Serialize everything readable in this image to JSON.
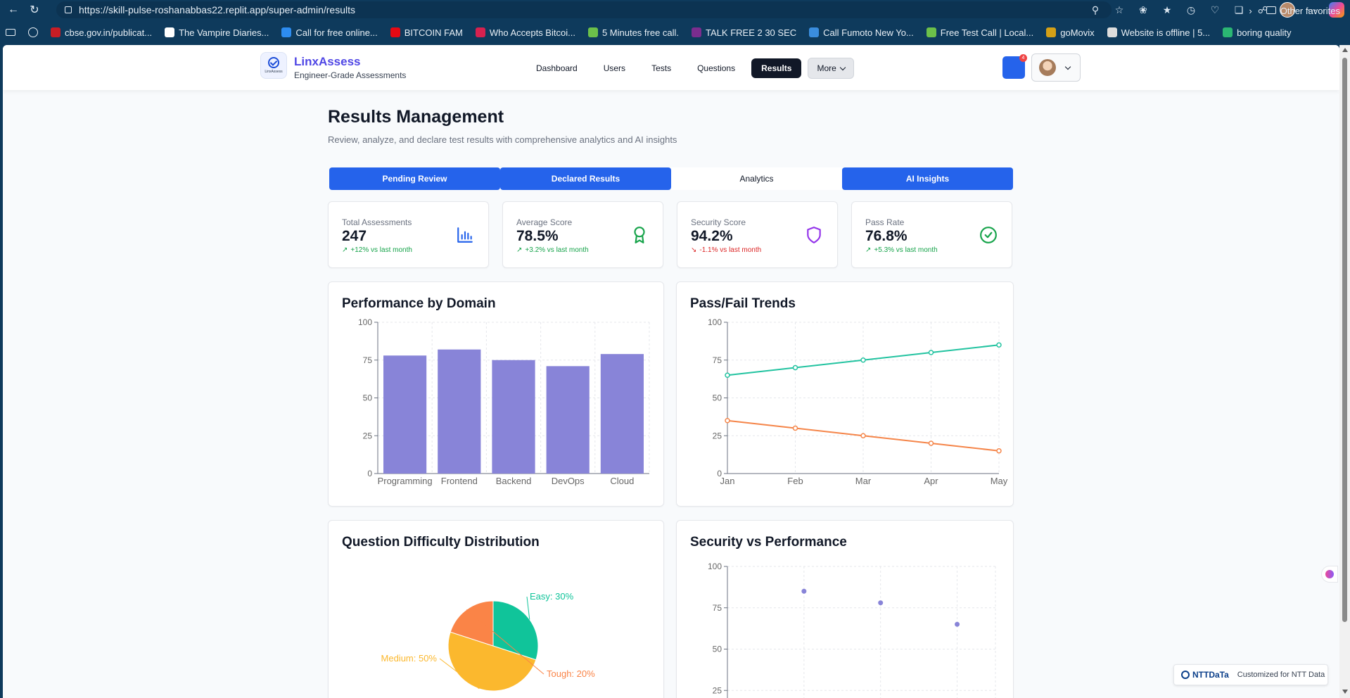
{
  "browser": {
    "url": "https://skill-pulse-roshanabbas22.replit.app/super-admin/results",
    "bookmarks": [
      {
        "label": "cbse.gov.in/publicat...",
        "color": "#c81d25"
      },
      {
        "label": "The Vampire Diaries...",
        "color": "#ffffff"
      },
      {
        "label": "Call for free online...",
        "color": "#2d8cf0"
      },
      {
        "label": "BITCOIN FAM",
        "color": "#e50914"
      },
      {
        "label": "Who Accepts Bitcoi...",
        "color": "#d6214f"
      },
      {
        "label": "5 Minutes free call.",
        "color": "#6cc04a"
      },
      {
        "label": "TALK FREE 2 30 SEC",
        "color": "#7b2d8e"
      },
      {
        "label": "Call Fumoto New Yo...",
        "color": "#3a8dde"
      },
      {
        "label": "Free Test Call | Local...",
        "color": "#6cc04a"
      },
      {
        "label": "goMovix",
        "color": "#d4a017"
      },
      {
        "label": "Website is offline | 5...",
        "color": "#dddddd"
      },
      {
        "label": "boring quality",
        "color": "#2bb673"
      }
    ],
    "other_favorites": "Other favorites"
  },
  "header": {
    "brand_name": "LinxAssess",
    "brand_sub": "Engineer-Grade Assessments",
    "logo_text": "LinxAssess",
    "nav": [
      "Dashboard",
      "Users",
      "Tests",
      "Questions",
      "Results"
    ],
    "active_nav": "Results",
    "more_label": "More",
    "notification_count": "4"
  },
  "page": {
    "title": "Results Management",
    "subtitle": "Review, analyze, and declare test results with comprehensive analytics and AI insights"
  },
  "tabs": [
    {
      "label": "Pending Review",
      "active": false
    },
    {
      "label": "Declared Results",
      "active": false
    },
    {
      "label": "Analytics",
      "active": true
    },
    {
      "label": "AI Insights",
      "active": false
    }
  ],
  "stats": [
    {
      "label": "Total Assessments",
      "value": "247",
      "trend": "+12% vs last month",
      "direction": "up",
      "icon": "bar-chart-icon",
      "color": "#2563eb"
    },
    {
      "label": "Average Score",
      "value": "78.5%",
      "trend": "+3.2% vs last month",
      "direction": "up",
      "icon": "award-icon",
      "color": "#16a34a"
    },
    {
      "label": "Security Score",
      "value": "94.2%",
      "trend": "-1.1% vs last month",
      "direction": "down",
      "icon": "shield-icon",
      "color": "#9333ea"
    },
    {
      "label": "Pass Rate",
      "value": "76.8%",
      "trend": "+5.3% vs last month",
      "direction": "up",
      "icon": "check-circle-icon",
      "color": "#16a34a"
    }
  ],
  "charts": {
    "performance_title": "Performance by Domain",
    "passfail_title": "Pass/Fail Trends",
    "difficulty_title": "Question Difficulty Distribution",
    "security_title": "Security vs Performance"
  },
  "chart_data": [
    {
      "type": "bar",
      "title": "Performance by Domain",
      "categories": [
        "Programming",
        "Frontend",
        "Backend",
        "DevOps",
        "Cloud"
      ],
      "values": [
        78,
        82,
        75,
        71,
        79
      ],
      "ylim": [
        0,
        100
      ],
      "yticks": [
        0,
        25,
        50,
        75,
        100
      ],
      "color": "#8884d8",
      "grid": true
    },
    {
      "type": "line",
      "title": "Pass/Fail Trends",
      "categories": [
        "Jan",
        "Feb",
        "Mar",
        "Apr",
        "May"
      ],
      "series": [
        {
          "values": [
            65,
            70,
            75,
            80,
            85
          ],
          "color": "#22c3a0"
        },
        {
          "values": [
            35,
            30,
            25,
            20,
            15
          ],
          "color": "#f58549"
        }
      ],
      "ylim": [
        0,
        100
      ],
      "yticks": [
        0,
        25,
        50,
        75,
        100
      ],
      "grid": true
    },
    {
      "type": "pie",
      "title": "Question Difficulty Distribution",
      "slices": [
        {
          "label": "Easy: 30%",
          "value": 30,
          "color": "#10c49a"
        },
        {
          "label": "Medium: 50%",
          "value": 50,
          "color": "#fbb82e"
        },
        {
          "label": "Tough: 20%",
          "value": 20,
          "color": "#fa8447"
        }
      ]
    },
    {
      "type": "scatter",
      "title": "Security vs Performance",
      "points": [
        {
          "x": 1,
          "y": 85
        },
        {
          "x": 2,
          "y": 78
        },
        {
          "x": 3,
          "y": 65
        }
      ],
      "xlim": [
        0,
        3.5
      ],
      "ylim": [
        0,
        100
      ],
      "yticks": [
        25,
        50,
        75,
        100
      ],
      "color": "#8884d8",
      "grid": true
    }
  ],
  "footer": {
    "ntt_logo": "NTTDaTa",
    "ntt_text": "Customized for NTT Data"
  }
}
